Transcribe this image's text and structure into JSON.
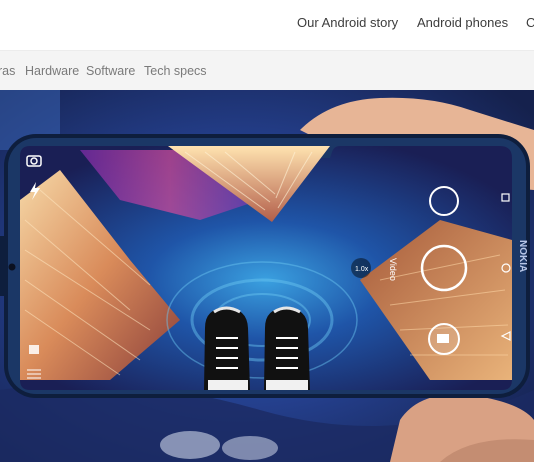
{
  "top_nav": {
    "items": [
      {
        "label": "Our Android story"
      },
      {
        "label": "Android phones"
      },
      {
        "label": "C"
      }
    ]
  },
  "sub_nav": {
    "items": [
      {
        "label": "ras"
      },
      {
        "label": "Hardware"
      },
      {
        "label": "Software"
      },
      {
        "label": "Tech specs"
      }
    ]
  },
  "hero": {
    "phone_brand": "NOKIA",
    "zoom_label": "1.0x",
    "mode_label": "Video",
    "icons": [
      "camera-icon",
      "flash-icon",
      "grid-icon",
      "shutter-button",
      "video-button",
      "back-icon",
      "home-icon",
      "recents-icon"
    ]
  }
}
